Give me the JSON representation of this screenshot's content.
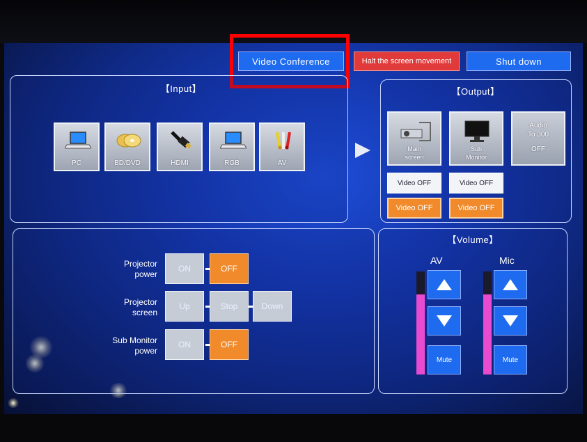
{
  "top_bar": {
    "video_conference": "Video Conference",
    "halt": "Halt the screen movement",
    "shut_down": "Shut down"
  },
  "input": {
    "title": "【Input】",
    "sources": [
      {
        "label": "PC",
        "icon": "laptop-icon"
      },
      {
        "label": "BD/DVD",
        "icon": "disc-icon"
      },
      {
        "label": "HDMI",
        "icon": "hdmi-cable-icon"
      },
      {
        "label": "RGB",
        "icon": "laptop-icon"
      },
      {
        "label": "AV",
        "icon": "av-cable-icon"
      }
    ]
  },
  "output": {
    "title": "【Output】",
    "main_screen": {
      "line1": "Main",
      "line2": "screen"
    },
    "sub_monitor": {
      "line1": "Sub",
      "line2": "Monitor"
    },
    "audio": {
      "line1": "Audio",
      "line2": "To 300",
      "line3": "OFF"
    },
    "video_off_1": "Video OFF",
    "video_off_2": "Video OFF",
    "video_off_3": "Video OFF",
    "video_off_4": "Video OFF"
  },
  "controls": {
    "projector_power": {
      "line1": "Projector",
      "line2": "power",
      "on": "ON",
      "off": "OFF"
    },
    "projector_screen": {
      "line1": "Projector",
      "line2": "screen",
      "up": "Up",
      "stop": "Stop",
      "down": "Down"
    },
    "sub_monitor_power": {
      "line1": "Sub Monitor",
      "line2": "power",
      "on": "ON",
      "off": "OFF"
    }
  },
  "volume": {
    "title": "【Volume】",
    "av": {
      "label": "AV",
      "level": 0.78,
      "mute": "Mute"
    },
    "mic": {
      "label": "Mic",
      "level": 0.78,
      "mute": "Mute"
    }
  },
  "colors": {
    "accent_blue": "#1e6bf0",
    "halt_red": "#e03a3a",
    "active_orange": "#f08a2a",
    "meter_pink": "#e94bd0",
    "highlight_red": "#ff0000"
  }
}
